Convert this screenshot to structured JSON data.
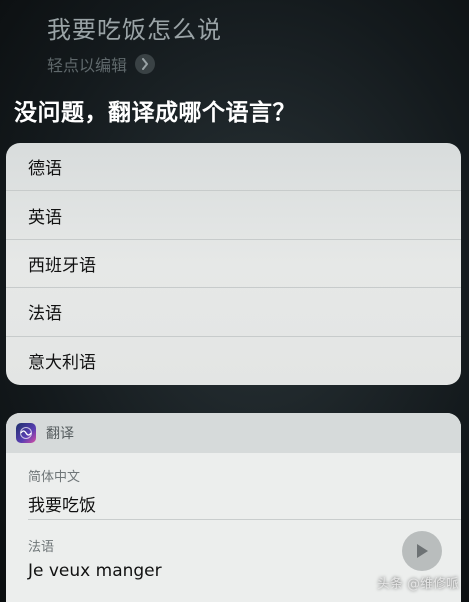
{
  "siri": {
    "query": "我要吃饭怎么说",
    "edit_hint": "轻点以编辑",
    "answer": "没问题，翻译成哪个语言？"
  },
  "languages": [
    "德语",
    "英语",
    "西班牙语",
    "法语",
    "意大利语"
  ],
  "translation": {
    "app_name": "翻译",
    "source_label": "简体中文",
    "source_text": "我要吃饭",
    "target_label": "法语",
    "target_text": "Je veux manger"
  },
  "watermark": "头条 @维修哌"
}
